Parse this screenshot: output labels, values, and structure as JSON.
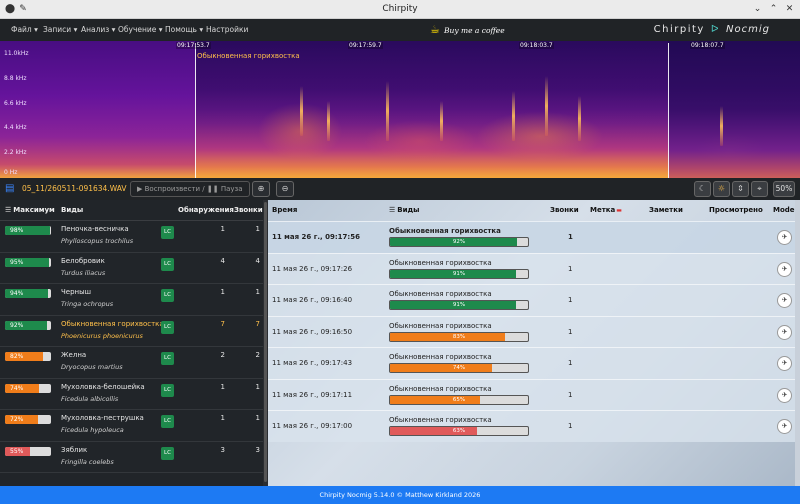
{
  "window": {
    "title": "Chirpity"
  },
  "menu": {
    "items": [
      "Файл",
      "Записи",
      "Анализ",
      "Обучение",
      "Помощь",
      "Настройки"
    ],
    "coffee_label": "Buy me a coffee",
    "brand_left": "Chirpity",
    "brand_right": "Nocmig"
  },
  "spectrogram": {
    "timestamps": [
      "09:17:53.7",
      "09:17:59.7",
      "09:18:03.7",
      "09:18:07.7"
    ],
    "freq_labels": [
      "11.0kHz",
      "8.8 kHz",
      "6.6 kHz",
      "4.4 kHz",
      "2.2 kHz",
      "0 Hz"
    ],
    "region_label": "Обыкновенная горихвостка"
  },
  "toolbar": {
    "file_name": "05_11/260511-091634.WAV",
    "play_label": "Воспроизвести /",
    "pause_label": "Пауза",
    "zoom_in_icon": "zoom-in-icon",
    "zoom_out_icon": "zoom-out-icon",
    "zoom_percent": "50%"
  },
  "summary": {
    "headers": {
      "max": "Максимум",
      "species": "Виды",
      "detections": "Обнаружения",
      "calls": "Звонки"
    },
    "rows": [
      {
        "max": 98,
        "max_label": "98%",
        "color": "#1e8a4c",
        "common": "Пеночка-весничка",
        "latin": "Phylloscopus trochilus",
        "status": "LC",
        "detections": "1",
        "calls": "1",
        "selected": false
      },
      {
        "max": 95,
        "max_label": "95%",
        "color": "#1e8a4c",
        "common": "Белобровик",
        "latin": "Turdus iliacus",
        "status": "LC",
        "detections": "4",
        "calls": "4",
        "selected": false
      },
      {
        "max": 94,
        "max_label": "94%",
        "color": "#1e8a4c",
        "common": "Черныш",
        "latin": "Tringa ochropus",
        "status": "LC",
        "detections": "1",
        "calls": "1",
        "selected": false
      },
      {
        "max": 92,
        "max_label": "92%",
        "color": "#1e8a4c",
        "common": "Обыкновенная горихвостка",
        "latin": "Phoenicurus phoenicurus",
        "status": "LC",
        "detections": "7",
        "calls": "7",
        "selected": true
      },
      {
        "max": 82,
        "max_label": "82%",
        "color": "#f07d1a",
        "common": "Желна",
        "latin": "Dryocopus martius",
        "status": "LC",
        "detections": "2",
        "calls": "2",
        "selected": false
      },
      {
        "max": 74,
        "max_label": "74%",
        "color": "#f07d1a",
        "common": "Мухоловка-белошейка",
        "latin": "Ficedula albicollis",
        "status": "LC",
        "detections": "1",
        "calls": "1",
        "selected": false
      },
      {
        "max": 72,
        "max_label": "72%",
        "color": "#f07d1a",
        "common": "Мухоловка-пеструшка",
        "latin": "Ficedula hypoleuca",
        "status": "LC",
        "detections": "1",
        "calls": "1",
        "selected": false
      },
      {
        "max": 55,
        "max_label": "55%",
        "color": "#e05a5a",
        "common": "Зяблик",
        "latin": "Fringilla coelebs",
        "status": "LC",
        "detections": "3",
        "calls": "3",
        "selected": false
      }
    ]
  },
  "results": {
    "headers": {
      "time": "Время",
      "species": "Виды",
      "calls": "Звонки",
      "label": "Метка",
      "notes": "Заметки",
      "reviewed": "Просмотрено",
      "model": "Model"
    },
    "rows": [
      {
        "time": "11 мая 26 г., 09:17:56",
        "species": "Обыкновенная горихвостка",
        "conf": 92,
        "conf_label": "92%",
        "color": "#1e8a4c",
        "calls": "1"
      },
      {
        "time": "11 мая 26 г., 09:17:26",
        "species": "Обыкновенная горихвостка",
        "conf": 91,
        "conf_label": "91%",
        "color": "#1e8a4c",
        "calls": "1"
      },
      {
        "time": "11 мая 26 г., 09:16:40",
        "species": "Обыкновенная горихвостка",
        "conf": 91,
        "conf_label": "91%",
        "color": "#1e8a4c",
        "calls": "1"
      },
      {
        "time": "11 мая 26 г., 09:16:50",
        "species": "Обыкновенная горихвостка",
        "conf": 83,
        "conf_label": "83%",
        "color": "#f07d1a",
        "calls": "1"
      },
      {
        "time": "11 мая 26 г., 09:17:43",
        "species": "Обыкновенная горихвостка",
        "conf": 74,
        "conf_label": "74%",
        "color": "#f07d1a",
        "calls": "1"
      },
      {
        "time": "11 мая 26 г., 09:17:11",
        "species": "Обыкновенная горихвостка",
        "conf": 65,
        "conf_label": "65%",
        "color": "#f07d1a",
        "calls": "1"
      },
      {
        "time": "11 мая 26 г., 09:17:00",
        "species": "Обыкновенная горихвостка",
        "conf": 63,
        "conf_label": "63%",
        "color": "#e05a5a",
        "calls": "1"
      }
    ]
  },
  "footer": {
    "text": "Chirpity Nocmig 5.14.0 © Matthew Kirkland 2026"
  }
}
